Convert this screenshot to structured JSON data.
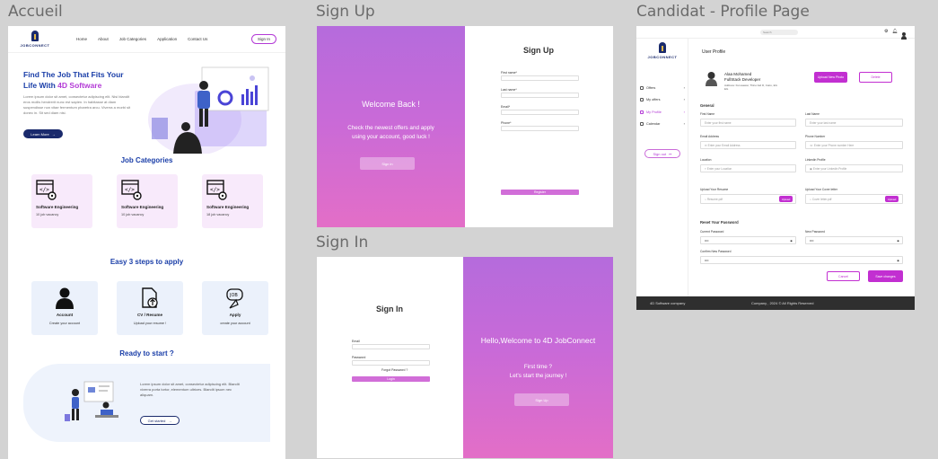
{
  "frames": {
    "accueil_label": "Accueil",
    "signup_label": "Sign Up",
    "signin_label": "Sign In",
    "candidat_label": "Candidat - Profile Page"
  },
  "brand": {
    "logo_text": "JOBCONNECT"
  },
  "accueil": {
    "nav": [
      "Home",
      "About",
      "Job Categories",
      "Application",
      "Contact Us"
    ],
    "signin_label": "Sign In",
    "hero_title_1": "Find The Job That Fits Your",
    "hero_title_2": "Life With ",
    "hero_title_accent": "4D Software",
    "hero_text": "Lorem ipsum dolor sit amet, consectetur adipiscing elit. Nisi blandit eros mollis hendrerit nunc est sapien. In habitasse at diam suspendisse non vitae fermentum pharetra arcu. Viverra a morbi sit donec in. Sit sed diam nisi.",
    "hero_button": "Learn More",
    "categories_title": "Job Categories",
    "categories": [
      {
        "name": "Software Engineering",
        "vacancy": "10 job vacancy"
      },
      {
        "name": "Software Engineering",
        "vacancy": "10 job vacancy"
      },
      {
        "name": "Software Engineering",
        "vacancy": "18 job vacancy"
      }
    ],
    "steps_title": "Easy 3 steps to apply",
    "steps": [
      {
        "title": "Account",
        "sub": "Create your account",
        "icon": "user-icon"
      },
      {
        "title": "CV / Resume",
        "sub": "Upload your resume !",
        "icon": "upload-doc-icon"
      },
      {
        "title": "Apply",
        "sub": "create your account",
        "icon": "job-apply-icon"
      }
    ],
    "ready_title": "Ready to start ?",
    "ready_text": "Lorem ipsum dolor sit amet, consectetur adipiscing elit. Blandit viverra porta tortor, elementum ultrices. Blandit ipsum nec aliquam.",
    "ready_button": "Get started"
  },
  "signup": {
    "welcome": "Welcome Back !",
    "subtitle_1": "Check the newest offers and apply",
    "subtitle_2": "using your account, good luck !",
    "left_button": "Sign in",
    "title": "Sign Up",
    "fields": [
      "First name*",
      "Last name*",
      "Email*",
      "Phone*"
    ],
    "submit": "Register"
  },
  "signin": {
    "title": "Sign In",
    "email_label": "Email",
    "password_label": "Password",
    "forgot": "Forgot Password ?",
    "submit": "Login",
    "welcome": "Hello,Welcome to 4D JobConnect",
    "first_time": "First time ?",
    "journey": "Let's start the journey !",
    "right_button": "Sign Up"
  },
  "candidat": {
    "search_placeholder": "Search",
    "menu": [
      {
        "label": "Offers",
        "active": false
      },
      {
        "label": "My offers",
        "active": false
      },
      {
        "label": "My Profile",
        "active": true
      },
      {
        "label": "Calendar",
        "active": false
      }
    ],
    "signout": "Sign out",
    "page_title": "User Profile",
    "user_name": "Alaa Mohamed",
    "user_role": "FullStack Developer",
    "user_address": "Address: Furusawat, Thiruv Ed D, Cairo, EG",
    "user_zip": "EG",
    "upload_photo": "Upload New Photo",
    "delete": "Delete",
    "general": "General",
    "first_name_label": "First Name",
    "first_name_ph": "Enter your first name",
    "last_name_label": "Last Name",
    "last_name_ph": "Enter your last name",
    "email_label": "Email Address",
    "email_ph": "Enter your Email Address",
    "phone_label": "Phone Number",
    "phone_ph": "Enter your Phone number Here",
    "location_label": "Location",
    "location_ph": "Enter your Location",
    "linkedin_label": "Linkedin Profile",
    "linkedin_ph": "Enter your Linkedin Profile",
    "resume_label": "Upload Your Resume",
    "resume_ph": "Resume.pdf",
    "cover_label": "Upload Your Cover letter",
    "cover_ph": "Cover letter.pdf",
    "upload": "Upload",
    "reset_title": "Reset Your Password",
    "current_pw_label": "Current Password",
    "new_pw_label": "New Password",
    "confirm_pw_label": "Confirm New Password",
    "pw_value": "••••",
    "cancel": "Cancel",
    "save": "Save changes",
    "footer_left": "4D Software company",
    "footer_center": "Company , 2024 © All Rights Reserved"
  }
}
